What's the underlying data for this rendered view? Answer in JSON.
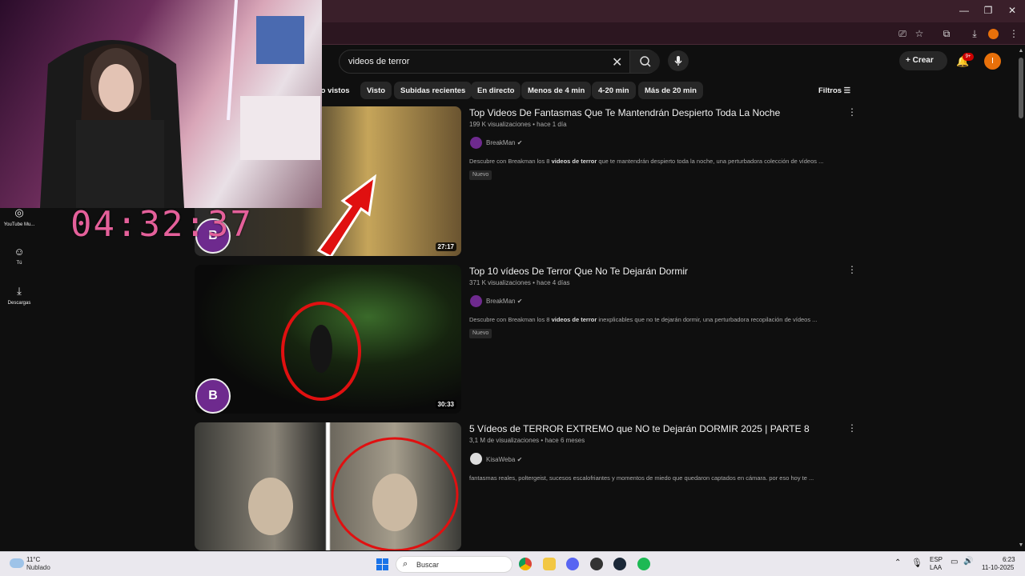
{
  "search": {
    "query": "videos de terror"
  },
  "header": {
    "create_label": "Crear",
    "notif_count": "9+",
    "avatar_initial": "I"
  },
  "chips": [
    "lo vistos",
    "Visto",
    "Subidas recientes",
    "En directo",
    "Menos de 4 min",
    "4-20 min",
    "Más de 20 min"
  ],
  "filters_label": "Filtros",
  "sidebar": {
    "items": [
      {
        "label": "YouTube Mu...",
        "icon": "youtube-music-icon"
      },
      {
        "label": "Tú",
        "icon": "user-icon"
      },
      {
        "label": "Descargas",
        "icon": "download-icon"
      }
    ]
  },
  "overlay": {
    "timer": "04:32:37"
  },
  "videos": [
    {
      "title": "Top Videos De Fantasmas Que Te Mantendrán Despierto Toda La Noche",
      "meta": "199 K visualizaciones • hace 1 día",
      "channel": "BreakMan",
      "desc_pre": "Descubre con Breakman los 8 ",
      "desc_bold": "videos de terror",
      "desc_post": " que te mantendrán despierto toda la noche, una perturbadora colección de vídeos ...",
      "badge": "Nuevo",
      "duration": "27:17"
    },
    {
      "title": "Top 10 vídeos De Terror Que No Te Dejarán Dormir",
      "meta": "371 K visualizaciones • hace 4 días",
      "channel": "BreakMan",
      "desc_pre": "Descubre con Breakman los 8 ",
      "desc_bold": "videos de terror",
      "desc_post": " inexplicables que no te dejarán dormir, una perturbadora recopilación de vídeos ...",
      "badge": "Nuevo",
      "duration": "30:33"
    },
    {
      "title": "5 Vídeos de TERROR EXTREMO que NO te Dejarán DORMIR 2025 | PARTE 8",
      "meta": "3,1 M de visualizaciones • hace 6 meses",
      "channel": "KisaWeba",
      "desc_pre": "fantasmas reales, poltergeist, sucesos escalofriantes y momentos de miedo que quedaron captados en cámara. por eso hoy te ...",
      "desc_bold": "",
      "desc_post": "",
      "badge": "",
      "duration": ""
    }
  ],
  "taskbar": {
    "weather_temp": "11°C",
    "weather_cond": "Nublado",
    "search_placeholder": "Buscar",
    "lang_top": "ESP",
    "lang_bottom": "LAA",
    "time": "6:23",
    "date": "11-10-2025"
  },
  "colors": {
    "accent_red": "#cc0000",
    "avatar_orange": "#e8700a",
    "timer_pink": "#e4609a"
  }
}
